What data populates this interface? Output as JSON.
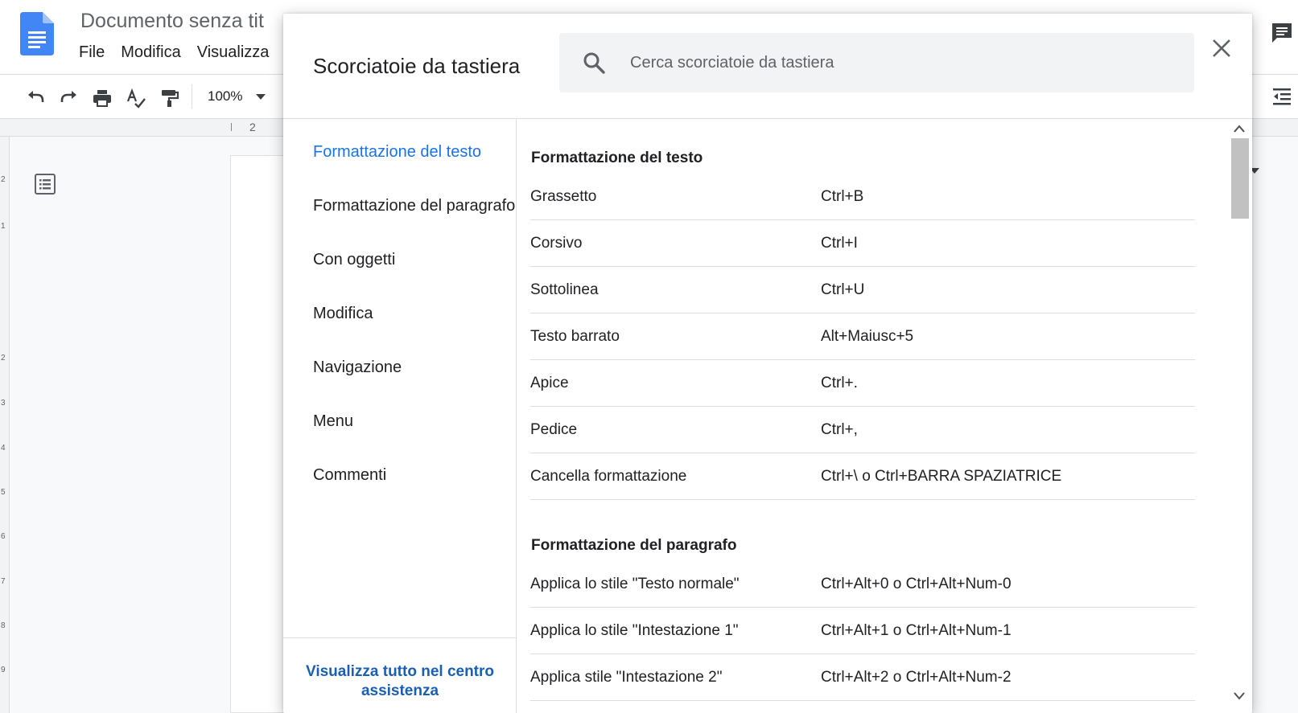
{
  "app": {
    "doc_title": "Documento senza tit",
    "menu": [
      "File",
      "Modifica",
      "Visualizza"
    ],
    "zoom": "100%",
    "ruler_number": "2",
    "vruler_numbers": [
      "2",
      "1",
      "2",
      "3",
      "4",
      "5",
      "6",
      "7",
      "8",
      "9"
    ]
  },
  "dialog": {
    "title": "Scorciatoie da tastiera",
    "search_placeholder": "Cerca scorciatoie da tastiera",
    "nav": [
      {
        "label": "Formattazione del testo",
        "active": true
      },
      {
        "label": "Formattazione del paragrafo",
        "active": false
      },
      {
        "label": "Con oggetti",
        "active": false
      },
      {
        "label": "Modifica",
        "active": false
      },
      {
        "label": "Navigazione",
        "active": false
      },
      {
        "label": "Menu",
        "active": false
      },
      {
        "label": "Commenti",
        "active": false
      }
    ],
    "help_link": "Visualizza tutto nel centro assistenza",
    "sections": [
      {
        "title": "Formattazione del testo",
        "shortcuts": [
          {
            "action": "Grassetto",
            "keys": "Ctrl+B"
          },
          {
            "action": "Corsivo",
            "keys": "Ctrl+I"
          },
          {
            "action": "Sottolinea",
            "keys": "Ctrl+U"
          },
          {
            "action": "Testo barrato",
            "keys": "Alt+Maiusc+5"
          },
          {
            "action": "Apice",
            "keys": "Ctrl+."
          },
          {
            "action": "Pedice",
            "keys": "Ctrl+,"
          },
          {
            "action": "Cancella formattazione",
            "keys": "Ctrl+\\ o Ctrl+BARRA SPAZIATRICE"
          }
        ]
      },
      {
        "title": "Formattazione del paragrafo",
        "shortcuts": [
          {
            "action": "Applica lo stile \"Testo normale\"",
            "keys": "Ctrl+Alt+0 o Ctrl+Alt+Num-0"
          },
          {
            "action": "Applica lo stile \"Intestazione 1\"",
            "keys": "Ctrl+Alt+1 o Ctrl+Alt+Num-1"
          },
          {
            "action": "Applica stile \"Intestazione 2\"",
            "keys": "Ctrl+Alt+2 o Ctrl+Alt+Num-2"
          }
        ]
      }
    ]
  },
  "colors": {
    "accent": "#1a73e8",
    "link": "#1a5fb4",
    "divider": "#dadce0",
    "docs_blue": "#4285f4"
  }
}
